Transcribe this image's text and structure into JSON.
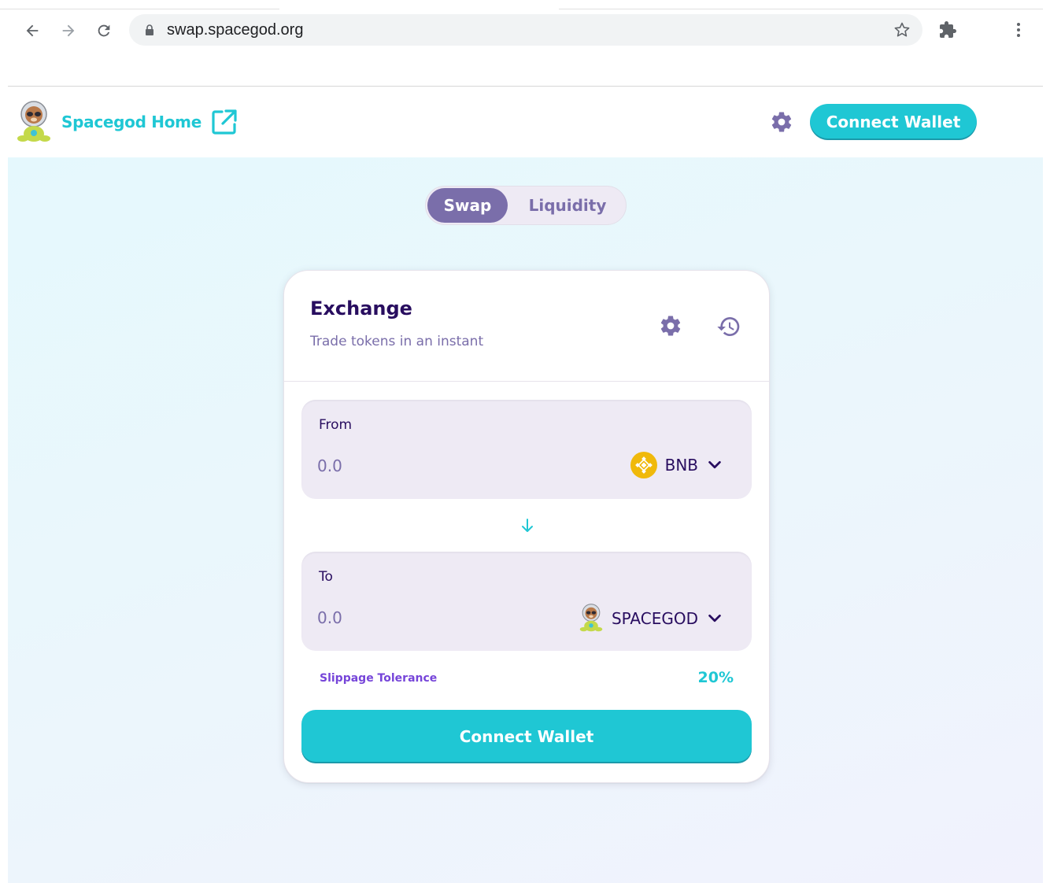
{
  "browser": {
    "url": "swap.spacegod.org"
  },
  "header": {
    "home_label": "Spacegod Home",
    "connect_label": "Connect Wallet"
  },
  "tabs": [
    {
      "label": "Swap",
      "active": true
    },
    {
      "label": "Liquidity",
      "active": false
    }
  ],
  "exchange": {
    "title": "Exchange",
    "subtitle": "Trade tokens in an instant",
    "from": {
      "label": "From",
      "placeholder": "0.0",
      "token": "BNB"
    },
    "to": {
      "label": "To",
      "placeholder": "0.0",
      "token": "SPACEGOD"
    },
    "slippage_label": "Slippage Tolerance",
    "slippage_value": "20%",
    "connect_label": "Connect Wallet"
  },
  "colors": {
    "accent": "#1fc7d4",
    "primary_text": "#280d5f",
    "secondary_text": "#7a6eaa",
    "bnb_yellow": "#f0b90b"
  },
  "icons": [
    "back-arrow-icon",
    "forward-arrow-icon",
    "reload-icon",
    "lock-icon",
    "star-icon",
    "puzzle-icon",
    "kebab-menu-icon",
    "external-link-icon",
    "gear-icon",
    "history-icon",
    "arrow-down-icon",
    "chevron-down-icon",
    "bnb-icon",
    "spacegod-logo"
  ]
}
